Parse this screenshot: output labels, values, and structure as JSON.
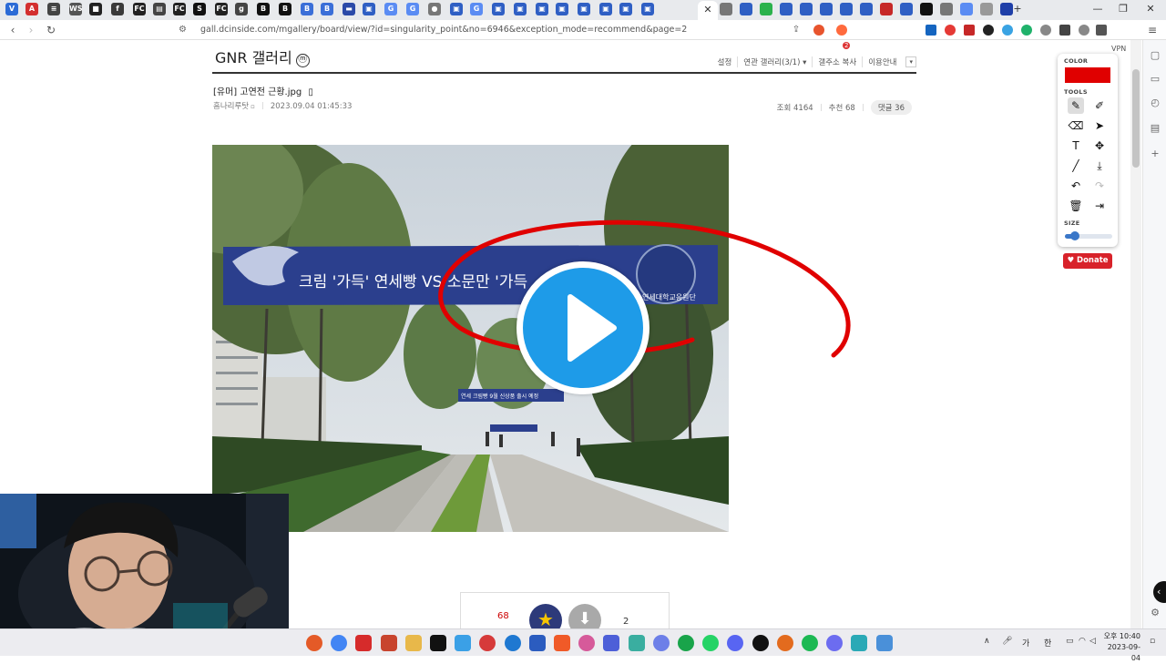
{
  "browser": {
    "active_tab_close": "✕",
    "new_tab": "+",
    "tab_icons": [
      {
        "label": "V",
        "color": "#2c6bd6"
      },
      {
        "label": "A",
        "color": "#d32f2f"
      },
      {
        "label": "≡",
        "color": "#444"
      },
      {
        "label": "WSJ",
        "color": "#555"
      },
      {
        "label": "■",
        "color": "#222"
      },
      {
        "label": "f",
        "color": "#3a3a3a"
      },
      {
        "label": "FC",
        "color": "#222"
      },
      {
        "label": "▤",
        "color": "#444"
      },
      {
        "label": "FC",
        "color": "#222"
      },
      {
        "label": "S",
        "color": "#111"
      },
      {
        "label": "FC",
        "color": "#222"
      },
      {
        "label": "g",
        "color": "#444"
      },
      {
        "label": "B",
        "color": "#111"
      },
      {
        "label": "B",
        "color": "#111"
      },
      {
        "label": "B",
        "color": "#3b6fd8"
      },
      {
        "label": "B",
        "color": "#3b6fd8"
      },
      {
        "label": "▬",
        "color": "#2b4aa8"
      },
      {
        "label": "▣",
        "color": "#2f5fc4"
      },
      {
        "label": "G",
        "color": "#5b8cf3"
      },
      {
        "label": "G",
        "color": "#5b8cf3"
      },
      {
        "label": "●",
        "color": "#777"
      },
      {
        "label": "▣",
        "color": "#2f5fc4"
      },
      {
        "label": "G",
        "color": "#5b8cf3"
      },
      {
        "label": "▣",
        "color": "#2f5fc4"
      },
      {
        "label": "▣",
        "color": "#2f5fc4"
      },
      {
        "label": "▣",
        "color": "#2f5fc4"
      },
      {
        "label": "▣",
        "color": "#2f5fc4"
      },
      {
        "label": "▣",
        "color": "#2f5fc4"
      },
      {
        "label": "▣",
        "color": "#2f5fc4"
      },
      {
        "label": "▣",
        "color": "#2f5fc4"
      },
      {
        "label": "▣",
        "color": "#2f5fc4"
      }
    ],
    "address_bar": {
      "url": "gall.dcinside.com/mgallery/board/view/?id=singularity_point&no=6946&exception_mode=recommend&page=2",
      "lock_icon": "tune-icon"
    },
    "vpn_label": "VPN",
    "extension_badge": "2"
  },
  "gallery": {
    "title": "GNR 갤러리",
    "minor_badge": "ⓜ",
    "nav": {
      "settings": "설정",
      "related": "연관 갤러리(3/1)",
      "copy_address": "갤주소 복사",
      "guide": "이용안내"
    }
  },
  "post": {
    "title": "[유머] 고연전 근황.jpg",
    "author": "흠나리루탓",
    "date": "2023.09.04 01:45:33",
    "views_label": "조회 4164",
    "recommend_label": "추천 68",
    "comments_label": "댓글 36"
  },
  "photo": {
    "banner_main": "크림 '가득' 연세빵 VS 소문만 '가득",
    "banner_small": "연세 크림빵 9월 신상품 출시 예정",
    "banner_org": "연세대학교응원단"
  },
  "drawing_tool": {
    "color_label": "COLOR",
    "current_color": "#e00000",
    "tools_label": "TOOLS",
    "size_label": "SIZE",
    "size_level": 0.22,
    "donate_label": "Donate",
    "tools": [
      {
        "name": "pen-icon",
        "glyph": "✎",
        "selected": true
      },
      {
        "name": "highlighter-icon",
        "glyph": "✐",
        "selected": false
      },
      {
        "name": "eraser-icon",
        "glyph": "⌫",
        "selected": false
      },
      {
        "name": "cursor-icon",
        "glyph": "➤",
        "selected": false
      },
      {
        "name": "text-icon",
        "glyph": "T",
        "selected": false
      },
      {
        "name": "move-icon",
        "glyph": "✥",
        "selected": false
      },
      {
        "name": "line-icon",
        "glyph": "╱",
        "selected": false
      },
      {
        "name": "download-icon",
        "glyph": "⤓",
        "selected": false
      },
      {
        "name": "undo-icon",
        "glyph": "↶",
        "selected": false
      },
      {
        "name": "redo-icon",
        "glyph": "↷",
        "selected": false
      },
      {
        "name": "trash-icon",
        "glyph": "🗑",
        "selected": false
      },
      {
        "name": "exit-icon",
        "glyph": "⇥",
        "selected": false
      }
    ]
  },
  "recommend_box": {
    "up_count": "68",
    "down_count": "2"
  },
  "taskbar": {
    "ime_label": "가",
    "ime_label2": "한",
    "time": "오후 10:40",
    "date": "2023-09-04"
  }
}
